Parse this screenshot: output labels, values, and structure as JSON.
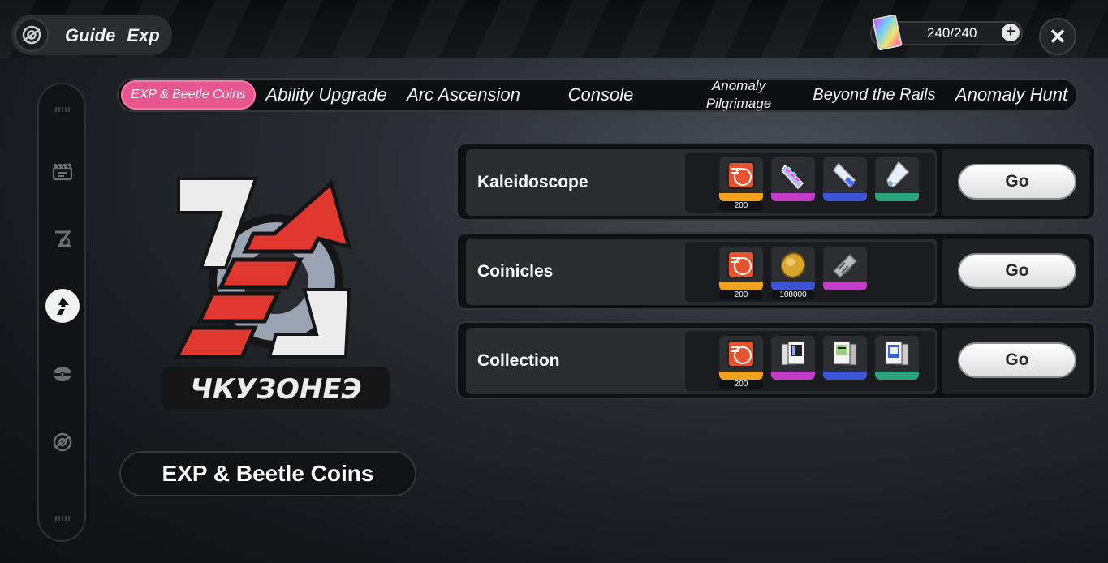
{
  "header": {
    "title": "Guide",
    "subtitle": "Exp",
    "stamina": "240/240",
    "stamina_plus": "+",
    "close": "✕"
  },
  "sidebar": {
    "items": [
      {
        "icon": "clapperboard-icon",
        "active": false
      },
      {
        "icon": "z-logo-icon",
        "active": false
      },
      {
        "icon": "upgrade-arrow-icon",
        "active": true
      },
      {
        "icon": "cap-icon",
        "active": false
      },
      {
        "icon": "swirl-icon",
        "active": false
      }
    ]
  },
  "tabs": [
    {
      "label": "EXP & Beetle Coins",
      "active": true
    },
    {
      "label": "Ability Upgrade",
      "active": false
    },
    {
      "label": "Arc Ascension",
      "active": false
    },
    {
      "label": "Console",
      "active": false
    },
    {
      "label_line1": "Anomaly",
      "label_line2": "Pilgrimage",
      "active": false
    },
    {
      "label": "Beyond the Rails",
      "active": false
    },
    {
      "label": "Anomaly Hunt",
      "active": false
    }
  ],
  "category_label": "EXP & Beetle Coins",
  "activities": [
    {
      "name": "Kaleidoscope",
      "go": "Go",
      "rewards": [
        {
          "icon": "exp-card-icon",
          "rarity": "gold",
          "count": "200"
        },
        {
          "icon": "kaleido-tube-icon",
          "rarity": "purple",
          "count": ""
        },
        {
          "icon": "blue-tube-icon",
          "rarity": "blue",
          "count": ""
        },
        {
          "icon": "green-tube-icon",
          "rarity": "green",
          "count": ""
        }
      ]
    },
    {
      "name": "Coinicles",
      "go": "Go",
      "rewards": [
        {
          "icon": "exp-card-icon",
          "rarity": "gold",
          "count": "200"
        },
        {
          "icon": "beetle-coin-icon",
          "rarity": "blue",
          "count": "108000"
        },
        {
          "icon": "spring-part-icon",
          "rarity": "purple",
          "count": ""
        }
      ]
    },
    {
      "name": "Collection",
      "go": "Go",
      "rewards": [
        {
          "icon": "exp-card-icon",
          "rarity": "gold",
          "count": "200"
        },
        {
          "icon": "card-stack-purple-icon",
          "rarity": "purple",
          "count": ""
        },
        {
          "icon": "card-stack-blue-icon",
          "rarity": "blue",
          "count": ""
        },
        {
          "icon": "card-stack-green-icon",
          "rarity": "green",
          "count": ""
        }
      ]
    }
  ],
  "emblem_text": "ЧКУЗОНЕЭ",
  "colors": {
    "accent_pink": "#e8568f",
    "rarity_gold": "#f0a21c",
    "rarity_purple": "#c23cc8",
    "rarity_blue": "#3c55d6",
    "rarity_green": "#2aa27a",
    "emblem_red": "#e0382f"
  }
}
